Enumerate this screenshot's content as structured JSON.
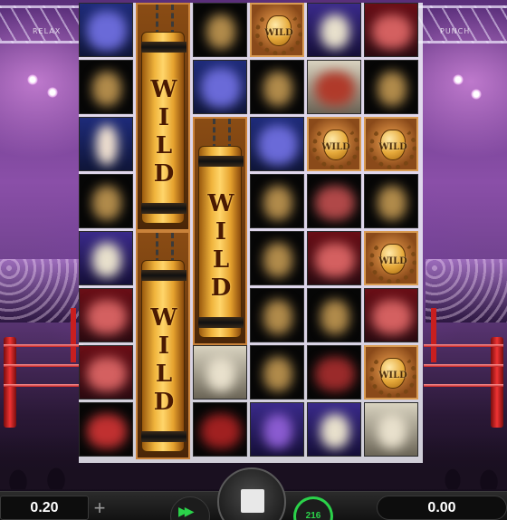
{
  "background": {
    "banner_left": "RELAX",
    "banner_right": "PUNCH"
  },
  "reels": {
    "wild_label": "WILD",
    "tall_wild_letters": "W\nI\nL\nD",
    "colors": {
      "wild_gold": "#f0b43c",
      "frame": "#c9823a"
    }
  },
  "controls": {
    "bet_value": "0.20",
    "plus_symbol": "+",
    "fast_forward_icon": "fast-forward-icon",
    "spin_icon": "stop-square-icon",
    "autoplay_count": "216",
    "win_value": "0.00",
    "accent_color": "#2bd24a"
  }
}
